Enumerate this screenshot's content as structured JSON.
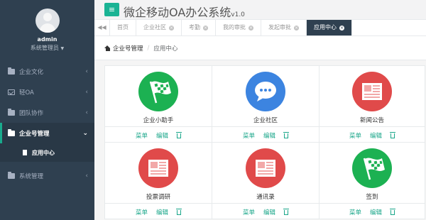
{
  "sidebar": {
    "user": {
      "name": "admin",
      "role": "系统管理员"
    },
    "items": [
      {
        "label": "企业文化"
      },
      {
        "label": "轻OA"
      },
      {
        "label": "团队协作"
      },
      {
        "label": "企业号管理"
      },
      {
        "label": "系统管理"
      }
    ],
    "subitem": {
      "label": "应用中心"
    }
  },
  "header": {
    "title": "微企移动OA办公系统",
    "version": "v1.0"
  },
  "tabs": [
    {
      "label": "首页"
    },
    {
      "label": "企业社区"
    },
    {
      "label": "考勤"
    },
    {
      "label": "我的审批"
    },
    {
      "label": "发起审批"
    },
    {
      "label": "应用中心"
    }
  ],
  "breadcrumb": {
    "root": "企业号管理",
    "sep": "/",
    "current": "应用中心"
  },
  "actions": {
    "menu": "菜单",
    "edit": "编辑"
  },
  "cards": [
    {
      "name": "企业小助手",
      "color": "#1cb152",
      "icon": "checkered-flag-icon"
    },
    {
      "name": "企业社区",
      "color": "#3c84e0",
      "icon": "chat-bubble-icon"
    },
    {
      "name": "新闻公告",
      "color": "#e04a4a",
      "icon": "newspaper-icon"
    },
    {
      "name": "投票调研",
      "color": "#e04a4a",
      "icon": "newspaper-icon"
    },
    {
      "name": "通讯录",
      "color": "#e04a4a",
      "icon": "newspaper-icon"
    },
    {
      "name": "签到",
      "color": "#1cb152",
      "icon": "checkered-flag-icon"
    }
  ]
}
